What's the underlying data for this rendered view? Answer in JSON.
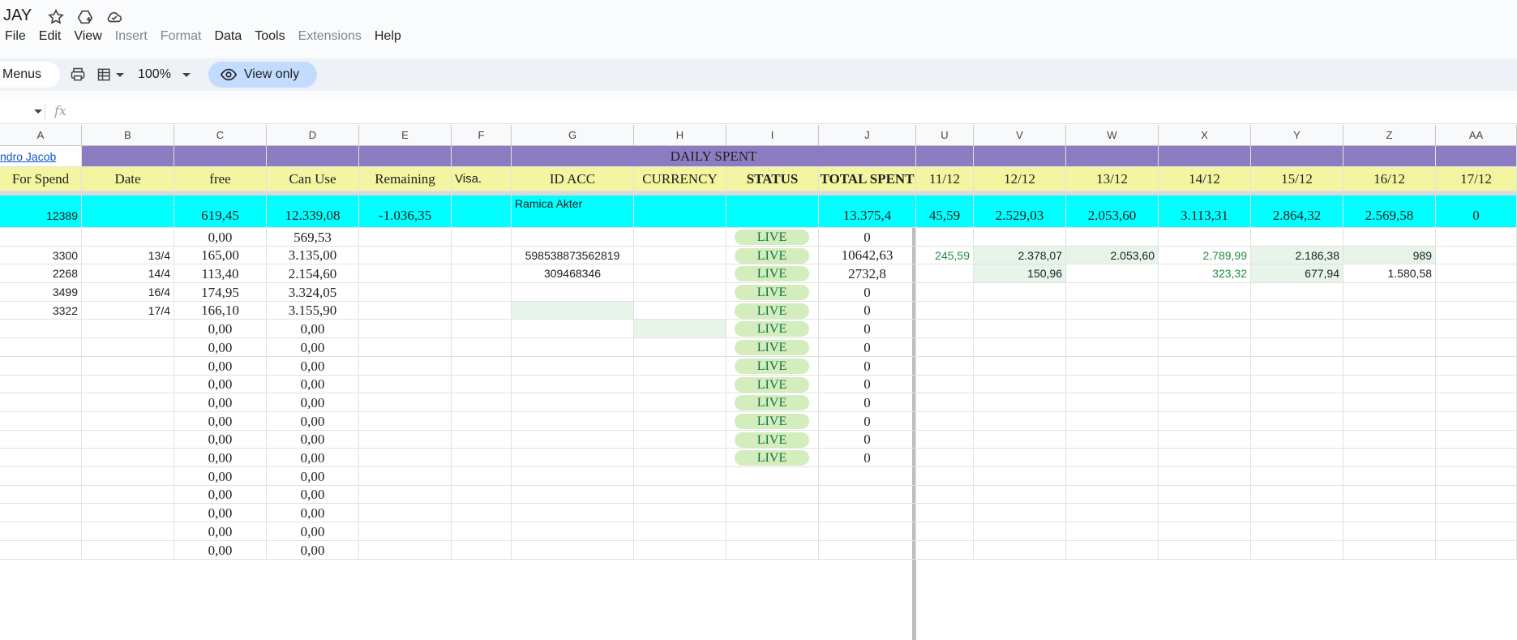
{
  "doc": {
    "title": "JAY"
  },
  "menu": [
    {
      "label": "File",
      "disabled": false
    },
    {
      "label": "Edit",
      "disabled": false
    },
    {
      "label": "View",
      "disabled": false
    },
    {
      "label": "Insert",
      "disabled": true
    },
    {
      "label": "Format",
      "disabled": true
    },
    {
      "label": "Data",
      "disabled": false
    },
    {
      "label": "Tools",
      "disabled": false
    },
    {
      "label": "Extensions",
      "disabled": true
    },
    {
      "label": "Help",
      "disabled": false
    }
  ],
  "toolbar": {
    "menus_label": "Menus",
    "zoom": "100%",
    "view_only": "View only"
  },
  "formula": {
    "fx": "fx"
  },
  "columns": [
    "A",
    "B",
    "C",
    "D",
    "E",
    "F",
    "G",
    "H",
    "I",
    "J",
    "U",
    "V",
    "W",
    "X",
    "Y",
    "Z",
    "AA"
  ],
  "banner": {
    "link": "ndro Jacob",
    "daily_spent": "DAILY SPENT"
  },
  "headers": [
    "For Spend",
    "Date",
    "free",
    "Can Use",
    "Remaining",
    "Visa.",
    "ID ACC",
    "CURRENCY",
    "STATUS",
    "TOTAL SPENT",
    "11/12",
    "12/12",
    "13/12",
    "14/12",
    "15/12",
    "16/12",
    "17/12"
  ],
  "totals": {
    "A": "12389",
    "C": "619,45",
    "D": "12.339,08",
    "E": "-1.036,35",
    "G": "Ramica Akter",
    "J": "13.375,4",
    "U": "45,59",
    "V": "2.529,03",
    "W": "2.053,60",
    "X": "3.113,31",
    "Y": "2.864,32",
    "Z": "2.569,58",
    "AA": "0"
  },
  "rows": [
    {
      "A": "",
      "B": "",
      "C": "0,00",
      "D": "569,53",
      "G": "",
      "I": "LIVE",
      "J": "0",
      "U": "",
      "V": "",
      "W": "",
      "X": "",
      "Y": "",
      "Z": ""
    },
    {
      "A": "3300",
      "B": "13/4",
      "C": "165,00",
      "D": "3.135,00",
      "G": "598538873562819",
      "I": "LIVE",
      "J": "10642,63",
      "U": "245,59",
      "V": "2.378,07",
      "W": "2.053,60",
      "X": "2.789,99",
      "Y": "2.186,38",
      "Z": "989"
    },
    {
      "A": "2268",
      "B": "14/4",
      "C": "113,40",
      "D": "2.154,60",
      "G": "309468346",
      "I": "LIVE",
      "J": "2732,8",
      "U": "",
      "V": "150,96",
      "W": "",
      "X": "323,32",
      "Y": "677,94",
      "Z": "1.580,58"
    },
    {
      "A": "3499",
      "B": "16/4",
      "C": "174,95",
      "D": "3.324,05",
      "G": "",
      "I": "LIVE",
      "J": "0",
      "U": "",
      "V": "",
      "W": "",
      "X": "",
      "Y": "",
      "Z": ""
    },
    {
      "A": "3322",
      "B": "17/4",
      "C": "166,10",
      "D": "3.155,90",
      "G": "",
      "I": "LIVE",
      "J": "0",
      "U": "",
      "V": "",
      "W": "",
      "X": "",
      "Y": "",
      "Z": ""
    },
    {
      "A": "",
      "B": "",
      "C": "0,00",
      "D": "0,00",
      "G": "",
      "I": "LIVE",
      "J": "0",
      "U": "",
      "V": "",
      "W": "",
      "X": "",
      "Y": "",
      "Z": ""
    },
    {
      "A": "",
      "B": "",
      "C": "0,00",
      "D": "0,00",
      "G": "",
      "I": "LIVE",
      "J": "0",
      "U": "",
      "V": "",
      "W": "",
      "X": "",
      "Y": "",
      "Z": ""
    },
    {
      "A": "",
      "B": "",
      "C": "0,00",
      "D": "0,00",
      "G": "",
      "I": "LIVE",
      "J": "0",
      "U": "",
      "V": "",
      "W": "",
      "X": "",
      "Y": "",
      "Z": ""
    },
    {
      "A": "",
      "B": "",
      "C": "0,00",
      "D": "0,00",
      "G": "",
      "I": "LIVE",
      "J": "0",
      "U": "",
      "V": "",
      "W": "",
      "X": "",
      "Y": "",
      "Z": ""
    },
    {
      "A": "",
      "B": "",
      "C": "0,00",
      "D": "0,00",
      "G": "",
      "I": "LIVE",
      "J": "0",
      "U": "",
      "V": "",
      "W": "",
      "X": "",
      "Y": "",
      "Z": ""
    },
    {
      "A": "",
      "B": "",
      "C": "0,00",
      "D": "0,00",
      "G": "",
      "I": "LIVE",
      "J": "0",
      "U": "",
      "V": "",
      "W": "",
      "X": "",
      "Y": "",
      "Z": ""
    },
    {
      "A": "",
      "B": "",
      "C": "0,00",
      "D": "0,00",
      "G": "",
      "I": "LIVE",
      "J": "0",
      "U": "",
      "V": "",
      "W": "",
      "X": "",
      "Y": "",
      "Z": ""
    },
    {
      "A": "",
      "B": "",
      "C": "0,00",
      "D": "0,00",
      "G": "",
      "I": "LIVE",
      "J": "0",
      "U": "",
      "V": "",
      "W": "",
      "X": "",
      "Y": "",
      "Z": ""
    },
    {
      "A": "",
      "B": "",
      "C": "0,00",
      "D": "0,00",
      "G": "",
      "I": "",
      "J": "",
      "U": "",
      "V": "",
      "W": "",
      "X": "",
      "Y": "",
      "Z": ""
    },
    {
      "A": "",
      "B": "",
      "C": "0,00",
      "D": "0,00",
      "G": "",
      "I": "",
      "J": "",
      "U": "",
      "V": "",
      "W": "",
      "X": "",
      "Y": "",
      "Z": ""
    },
    {
      "A": "",
      "B": "",
      "C": "0,00",
      "D": "0,00",
      "G": "",
      "I": "",
      "J": "",
      "U": "",
      "V": "",
      "W": "",
      "X": "",
      "Y": "",
      "Z": ""
    },
    {
      "A": "",
      "B": "",
      "C": "0,00",
      "D": "0,00",
      "G": "",
      "I": "",
      "J": "",
      "U": "",
      "V": "",
      "W": "",
      "X": "",
      "Y": "",
      "Z": ""
    },
    {
      "A": "",
      "B": "",
      "C": "0,00",
      "D": "0,00",
      "G": "",
      "I": "",
      "J": "",
      "U": "",
      "V": "",
      "W": "",
      "X": "",
      "Y": "",
      "Z": ""
    }
  ],
  "colors": {
    "purple": "#8e7cc3",
    "yellow": "#f4f5a0",
    "cyan": "#00ffff",
    "live_bg": "#d4edbc",
    "green_text": "#1e8e3e"
  }
}
